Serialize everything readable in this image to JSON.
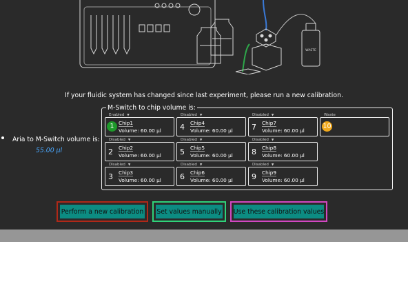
{
  "calibration": {
    "message": "If your fluidic system has changed since last experiment, please run a new calibration.",
    "aria": {
      "label": "Aria to M-Switch volume is:",
      "value": "55.00 µl"
    },
    "group_title": "M-Switch to chip volume is:",
    "chips": [
      {
        "status": "Enabled",
        "number": "1",
        "name": "Chip1",
        "volume": "Volume: 60.00 µl"
      },
      {
        "status": "Disabled",
        "number": "2",
        "name": "Chip2",
        "volume": "Volume: 60.00 µl"
      },
      {
        "status": "Disabled",
        "number": "3",
        "name": "Chip3",
        "volume": "Volume: 60.00 µl"
      },
      {
        "status": "Disabled",
        "number": "4",
        "name": "Chip4",
        "volume": "Volume: 60.00 µl"
      },
      {
        "status": "Disabled",
        "number": "5",
        "name": "Chip5",
        "volume": "Volume: 60.00 µl"
      },
      {
        "status": "Disabled",
        "number": "6",
        "name": "Chip6",
        "volume": "Volume: 60.00 µl"
      },
      {
        "status": "Disabled",
        "number": "7",
        "name": "Chip7",
        "volume": "Volume: 60.00 µl"
      },
      {
        "status": "Disabled",
        "number": "8",
        "name": "Chip8",
        "volume": "Volume: 60.00 µl"
      },
      {
        "status": "Disabled",
        "number": "9",
        "name": "Chip9",
        "volume": "Volume: 60.00 µl"
      },
      {
        "status": "Waste",
        "number": "10",
        "name": "",
        "volume": ""
      }
    ],
    "buttons": {
      "new_calibration": "Perform a new calibration",
      "set_manually": "Set values manually",
      "use_values": "Use these calibration values"
    },
    "illustration": {
      "bottle_label": "WASTE"
    },
    "colors": {
      "background": "#2a2a2a",
      "button_fill": "#0c8c82",
      "frame_red": "#b02818",
      "frame_green": "#2fd37a",
      "frame_pink": "#d247c2",
      "enabled_badge": "#1e9a2a",
      "waste_badge": "#f2a91b",
      "value_blue": "#4aa8ff"
    }
  }
}
